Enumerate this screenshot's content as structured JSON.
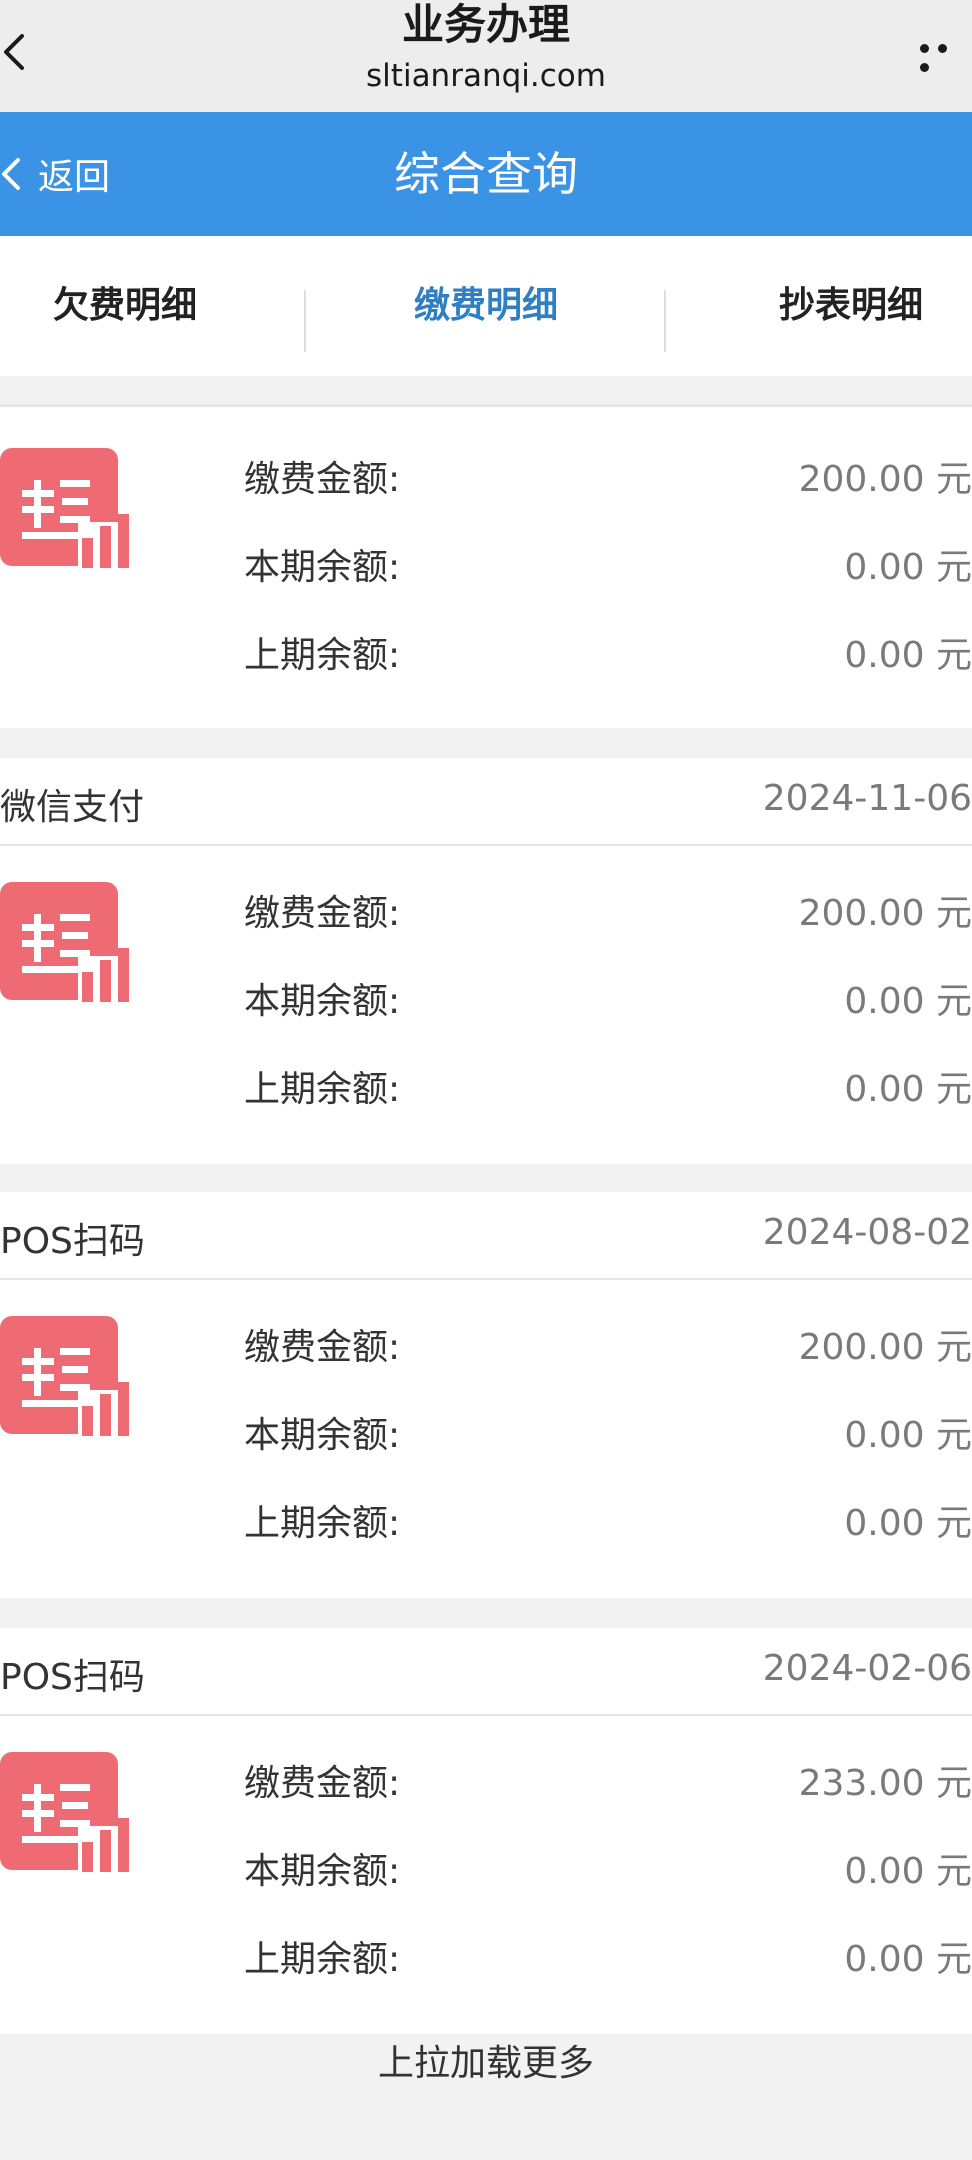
{
  "browser": {
    "title": "业务办理",
    "domain": "sltianranqi.com",
    "back_icon": "chevron-left-icon",
    "more_icon": "more-dots-icon"
  },
  "header": {
    "back_label": "返回",
    "title": "综合查询",
    "bg_color": "#3b93e6"
  },
  "tabs": [
    {
      "label": "欠费明细",
      "active": false
    },
    {
      "label": "缴费明细",
      "active": true
    },
    {
      "label": "抄表明细",
      "active": false
    }
  ],
  "records": [
    {
      "method": "",
      "date": "",
      "icon": "payment-receipt-icon",
      "rows": [
        {
          "label": "缴费金额:",
          "value": "200.00 元"
        },
        {
          "label": "本期余额:",
          "value": "0.00 元"
        },
        {
          "label": "上期余额:",
          "value": "0.00 元"
        }
      ]
    },
    {
      "method": "微信支付",
      "date": "2024-11-06",
      "icon": "payment-receipt-icon",
      "rows": [
        {
          "label": "缴费金额:",
          "value": "200.00 元"
        },
        {
          "label": "本期余额:",
          "value": "0.00 元"
        },
        {
          "label": "上期余额:",
          "value": "0.00 元"
        }
      ]
    },
    {
      "method": "POS扫码",
      "date": "2024-08-02",
      "icon": "payment-receipt-icon",
      "rows": [
        {
          "label": "缴费金额:",
          "value": "200.00 元"
        },
        {
          "label": "本期余额:",
          "value": "0.00 元"
        },
        {
          "label": "上期余额:",
          "value": "0.00 元"
        }
      ]
    },
    {
      "method": "POS扫码",
      "date": "2024-02-06",
      "icon": "payment-receipt-icon",
      "rows": [
        {
          "label": "缴费金额:",
          "value": "233.00 元"
        },
        {
          "label": "本期余额:",
          "value": "0.00 元"
        },
        {
          "label": "上期余额:",
          "value": "0.00 元"
        }
      ]
    }
  ],
  "load_more": "上拉加载更多",
  "colors": {
    "accent": "#3b93e6",
    "active_tab": "#2f7fc2",
    "icon": "#ee6b73"
  }
}
